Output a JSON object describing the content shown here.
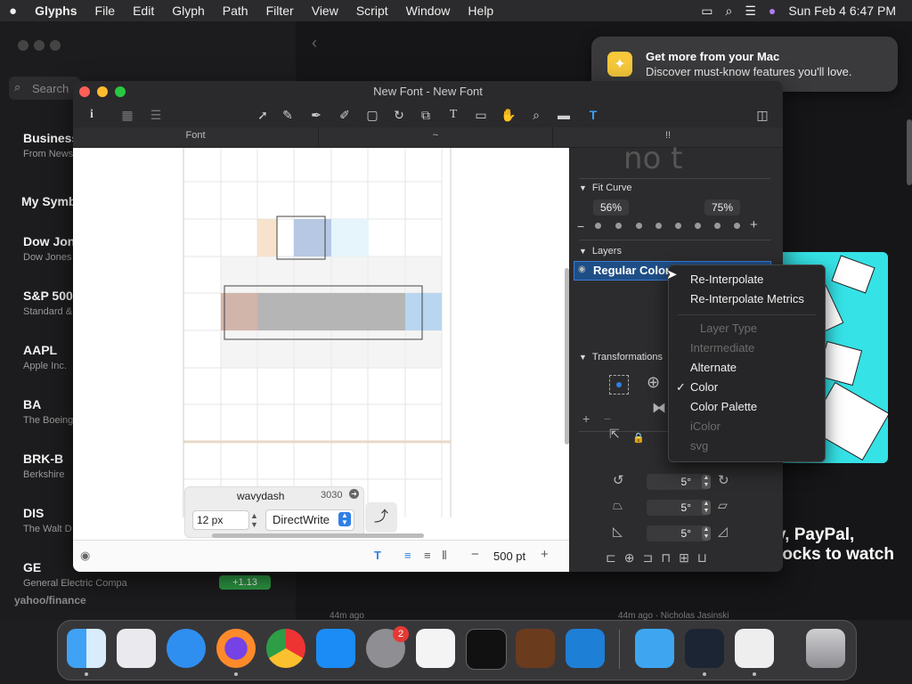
{
  "menubar": {
    "app": "Glyphs",
    "items": [
      "File",
      "Edit",
      "Glyph",
      "Path",
      "Filter",
      "View",
      "Script",
      "Window",
      "Help"
    ],
    "clock": "Sun Feb 4  6:47 PM"
  },
  "notification": {
    "title": "Get more from your Mac",
    "body": "Discover must-know features you'll love."
  },
  "stocks": {
    "search_placeholder": "Search",
    "header": "Business",
    "header_sub": "From  News",
    "my_symbols": "My Symbols",
    "footer": "yahoo/finance",
    "rows": [
      {
        "symbol": "Dow Jones",
        "name": "Dow Jones"
      },
      {
        "symbol": "S&P 500",
        "name": "Standard &"
      },
      {
        "symbol": "AAPL",
        "name": "Apple Inc."
      },
      {
        "symbol": "BA",
        "name": "The Boeing"
      },
      {
        "symbol": "BRK-B",
        "name": "Berkshire"
      },
      {
        "symbol": "DIS",
        "name": "The Walt D"
      },
      {
        "symbol": "GE",
        "name": "General Electric Compa"
      }
    ],
    "ge_change": "+1.13",
    "news_time_1": "44m ago",
    "news_time_2": "44m ago · Nicholas Jasinski",
    "promo_text": "y, PayPal, tocks to watch"
  },
  "glyphs_window": {
    "title": "New Font - New Font",
    "tabs": [
      "Font",
      "~",
      "!!"
    ],
    "preview_text": "no t",
    "glyph_name": "wavydash",
    "glyph_code": "3030",
    "font_size": "12 px",
    "renderer": "DirectWrite",
    "zoom": "500 pt",
    "sidebar": {
      "fit_curve_label": "Fit Curve",
      "fit_left": "56%",
      "fit_right": "75%",
      "layers_label": "Layers",
      "layer_name": "Regular Color",
      "transformations_label": "Transformations",
      "angle_1": "5°",
      "angle_2": "5°",
      "angle_3": "5°"
    }
  },
  "context_menu": {
    "items": [
      {
        "label": "Re-Interpolate",
        "enabled": true
      },
      {
        "label": "Re-Interpolate Metrics",
        "enabled": true
      },
      {
        "label": "Layer Type",
        "enabled": false
      },
      {
        "label": "Intermediate",
        "enabled": false
      },
      {
        "label": "Alternate",
        "enabled": true
      },
      {
        "label": "Color",
        "enabled": true,
        "checked": true
      },
      {
        "label": "Color Palette",
        "enabled": true
      },
      {
        "label": "iColor",
        "enabled": false
      },
      {
        "label": "svg",
        "enabled": false
      }
    ],
    "check_mark": "✓"
  },
  "dock": {
    "settings_badge": "2"
  }
}
